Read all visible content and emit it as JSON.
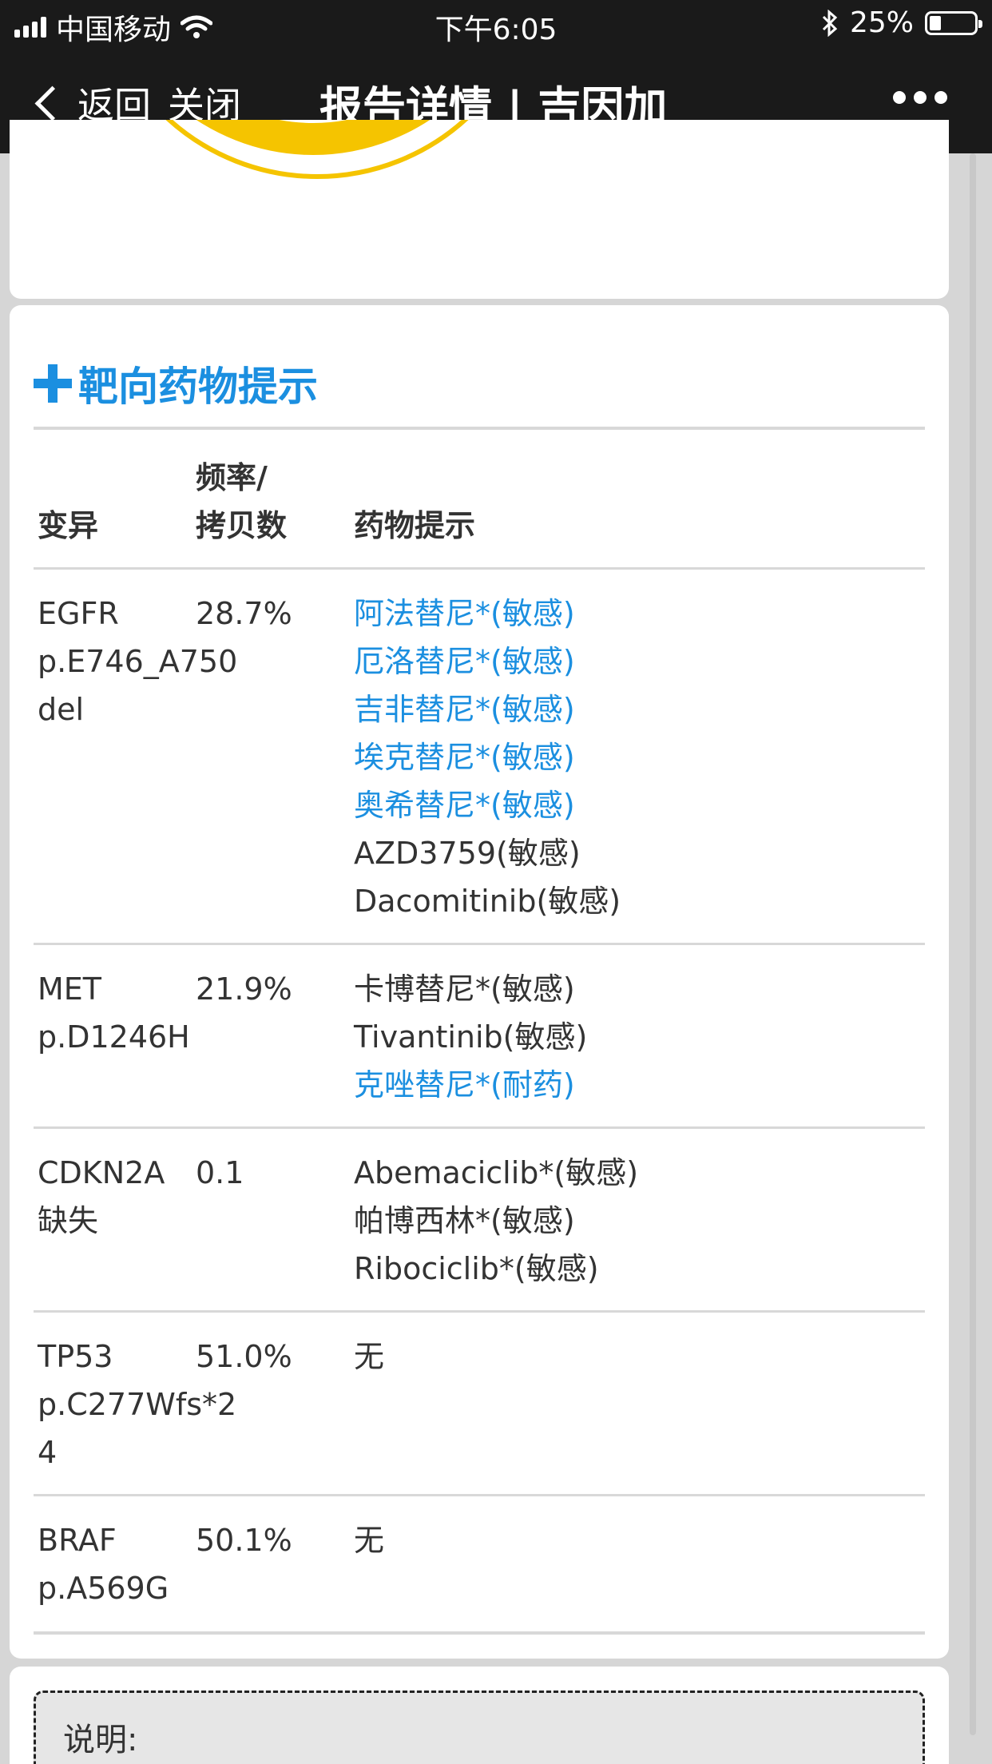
{
  "status_bar": {
    "carrier": "中国移动",
    "time": "下午6:05",
    "battery": "25%",
    "battery_level": 0.25
  },
  "nav": {
    "back_label": "返回",
    "close_label": "关闭",
    "title": "报告详情 | 吉因加"
  },
  "section": {
    "title": "靶向药物提示"
  },
  "table": {
    "headers": {
      "variant": "变异",
      "freq_line1": "频率/",
      "freq_line2": "拷贝数",
      "drug": "药物提示"
    },
    "rows": [
      {
        "variant_line1": "EGFR",
        "variant_line2": "p.E746_A750",
        "variant_line3": "del",
        "freq": "28.7%",
        "drugs": [
          {
            "text": "阿法替尼*(敏感)",
            "link": true
          },
          {
            "text": "厄洛替尼*(敏感)",
            "link": true
          },
          {
            "text": "吉非替尼*(敏感)",
            "link": true
          },
          {
            "text": "埃克替尼*(敏感)",
            "link": true
          },
          {
            "text": "奥希替尼*(敏感)",
            "link": true
          },
          {
            "text": "AZD3759(敏感)",
            "link": false
          },
          {
            "text": "Dacomitinib(敏感)",
            "link": false
          }
        ]
      },
      {
        "variant_line1": "MET",
        "variant_line2": "p.D1246H",
        "freq": "21.9%",
        "drugs": [
          {
            "text": "卡博替尼*(敏感)",
            "link": false
          },
          {
            "text": "Tivantinib(敏感)",
            "link": false
          },
          {
            "text": "克唑替尼*(耐药)",
            "link": true
          }
        ]
      },
      {
        "variant_line1": "CDKN2A",
        "variant_line2": "缺失",
        "freq": "0.1",
        "drugs": [
          {
            "text": "Abemaciclib*(敏感)",
            "link": false
          },
          {
            "text": "帕博西林*(敏感)",
            "link": false
          },
          {
            "text": "Ribociclib*(敏感)",
            "link": false
          }
        ]
      },
      {
        "variant_line1": "TP53",
        "variant_line2": "p.C277Wfs*2",
        "variant_line3": "4",
        "freq": "51.0%",
        "drugs": [
          {
            "text": "无",
            "link": false
          }
        ]
      },
      {
        "variant_line1": "BRAF",
        "variant_line2": "p.A569G",
        "freq": "50.1%",
        "drugs": [
          {
            "text": "无",
            "link": false
          }
        ]
      }
    ]
  },
  "note": {
    "label": "说明:"
  },
  "colors": {
    "topbar": "#1a1a1a",
    "accent_blue": "#1b8fe0",
    "ring_yellow": "#f5c400"
  }
}
